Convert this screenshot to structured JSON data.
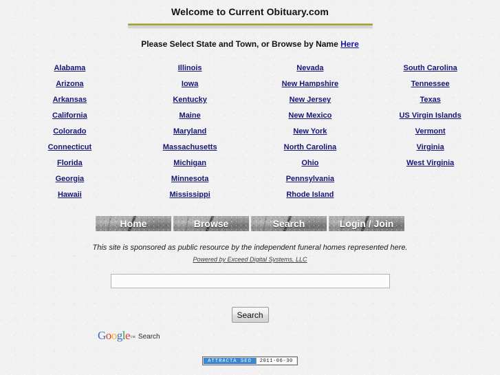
{
  "header": {
    "title": "Welcome to Current Obituary.com",
    "subtitle_prefix": "Please Select State and Town, or Browse by Name ",
    "subtitle_link": "Here"
  },
  "colors": {
    "link_navy": "#151574",
    "gold_rule": "#a8a447",
    "badge_blue": "#3c87d0",
    "page_bg": "#f1f1f1"
  },
  "states": {
    "columns": [
      {
        "items": [
          "Alabama",
          "Arizona",
          "Arkansas",
          "California",
          "Colorado",
          "Connecticut",
          "Florida",
          "Georgia",
          "Hawaii"
        ]
      },
      {
        "items": [
          "Illinois",
          "Iowa",
          "Kentucky",
          "Maine",
          "Maryland",
          "Massachusetts",
          "Michigan",
          "Minnesota",
          "Mississippi"
        ]
      },
      {
        "items": [
          "Nevada",
          "New Hampshire",
          "New Jersey",
          "New Mexico",
          "New York",
          "North Carolina",
          "Ohio",
          "Pennsylvania",
          "Rhode Island"
        ]
      },
      {
        "items": [
          "South Carolina",
          "Tennessee",
          "Texas",
          "US Virgin Islands",
          "Vermont",
          "Virginia",
          "West Virginia"
        ]
      }
    ]
  },
  "nav": {
    "buttons": [
      {
        "label": "Home"
      },
      {
        "label": "Browse"
      },
      {
        "label": "Search"
      },
      {
        "label": "Login / Join"
      }
    ]
  },
  "footer": {
    "sponsor": "This site is sponsored as public resource by the independent funeral homes represented here.",
    "powered_by": "Powered by Exceed Digital Systems, LLC"
  },
  "search": {
    "value": "",
    "placeholder": "",
    "button_label": "Search",
    "google": {
      "letters": [
        "G",
        "o",
        "o",
        "g",
        "l",
        "e"
      ],
      "tm": "™",
      "label": "Search"
    }
  },
  "badge": {
    "name": "ATTRACTA SEO",
    "date": "2011-06-30"
  }
}
